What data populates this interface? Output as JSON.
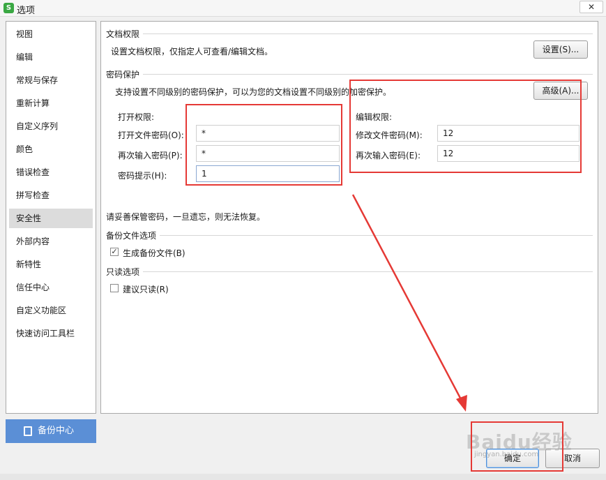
{
  "window": {
    "title": "选项",
    "app_icon_glyph": "S",
    "close_glyph": "✕"
  },
  "sidebar": {
    "items": [
      {
        "label": "视图"
      },
      {
        "label": "编辑"
      },
      {
        "label": "常规与保存"
      },
      {
        "label": "重新计算"
      },
      {
        "label": "自定义序列"
      },
      {
        "label": "颜色"
      },
      {
        "label": "错误检查"
      },
      {
        "label": "拼写检查"
      },
      {
        "label": "安全性",
        "active": true
      },
      {
        "label": "外部内容"
      },
      {
        "label": "新特性"
      },
      {
        "label": "信任中心"
      },
      {
        "label": "自定义功能区"
      },
      {
        "label": "快速访问工具栏"
      }
    ],
    "backup_center_label": "备份中心"
  },
  "doc_permissions": {
    "heading": "文档权限",
    "description": "设置文档权限，仅指定人可查看/编辑文档。",
    "settings_button": "设置(S)..."
  },
  "password_protection": {
    "heading": "密码保护",
    "description": "支持设置不同级别的密码保护，可以为您的文档设置不同级别的加密保护。",
    "advanced_button": "高级(A)...",
    "open": {
      "heading": "打开权限:",
      "password_label": "打开文件密码(O):",
      "password_value": "*",
      "confirm_label": "再次输入密码(P):",
      "confirm_value": "*",
      "hint_label": "密码提示(H):",
      "hint_value": "1"
    },
    "edit": {
      "heading": "编辑权限:",
      "password_label": "修改文件密码(M):",
      "password_value": "12",
      "confirm_label": "再次输入密码(E):",
      "confirm_value": "12"
    },
    "warning": "请妥善保管密码，一旦遗忘，则无法恢复。"
  },
  "backup_options": {
    "heading": "备份文件选项",
    "create_backup_label": "生成备份文件(B)",
    "create_backup_checked": true,
    "checkmark_glyph": "✓"
  },
  "readonly_options": {
    "heading": "只读选项",
    "recommend_readonly_label": "建议只读(R)",
    "recommend_readonly_checked": false
  },
  "footer": {
    "ok_label": "确定",
    "cancel_label": "取消"
  },
  "watermark": {
    "text": "Baidu经验",
    "url": "jingyan.baidu.com"
  },
  "colors": {
    "annotation_red": "#e53935",
    "backup_button_blue": "#5b8fd6",
    "active_item_bg": "#dcdcdc"
  }
}
